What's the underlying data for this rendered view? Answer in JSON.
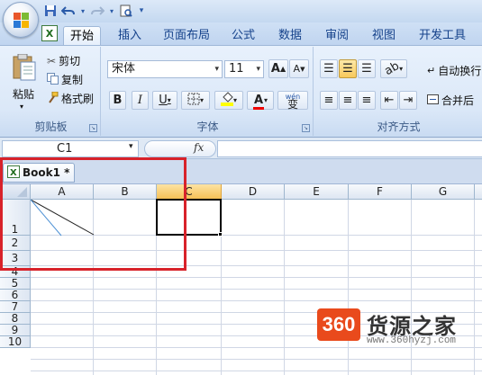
{
  "colors": {
    "accent": "#15428b",
    "highlight": "#e94a1c",
    "annotation": "#d8222a"
  },
  "quick_access": {
    "icons": [
      "save-icon",
      "undo-icon",
      "redo-icon",
      "print-preview-icon",
      "customize-icon"
    ]
  },
  "tabs": [
    "开始",
    "插入",
    "页面布局",
    "公式",
    "数据",
    "审阅",
    "视图",
    "开发工具"
  ],
  "clipboard": {
    "paste_label": "粘贴",
    "cut_label": "剪切",
    "copy_label": "复制",
    "format_painter_label": "格式刷",
    "group_label": "剪贴板"
  },
  "font": {
    "font_name": "宋体",
    "font_size": "11",
    "bold": "B",
    "italic": "I",
    "underline": "U",
    "font_color_letter": "A",
    "wen_label": "wén",
    "wen_char": "变",
    "grow": "A",
    "shrink": "A",
    "group_label": "字体"
  },
  "alignment": {
    "wrap_label": "自动换行",
    "merge_label": "合并后",
    "group_label": "对齐方式"
  },
  "formula_bar": {
    "name_box": "C1",
    "fx": "fx"
  },
  "workbook": {
    "title": "Book1 *"
  },
  "sheet": {
    "columns": [
      "A",
      "B",
      "C",
      "D",
      "E",
      "F",
      "G"
    ],
    "rows": [
      "1",
      "2",
      "3",
      "4",
      "5",
      "6",
      "7",
      "8",
      "9",
      "10"
    ],
    "active_cell": "C1"
  },
  "watermark": {
    "logo": "360",
    "text": "货源之家",
    "url": "www.360hyzj.com"
  }
}
